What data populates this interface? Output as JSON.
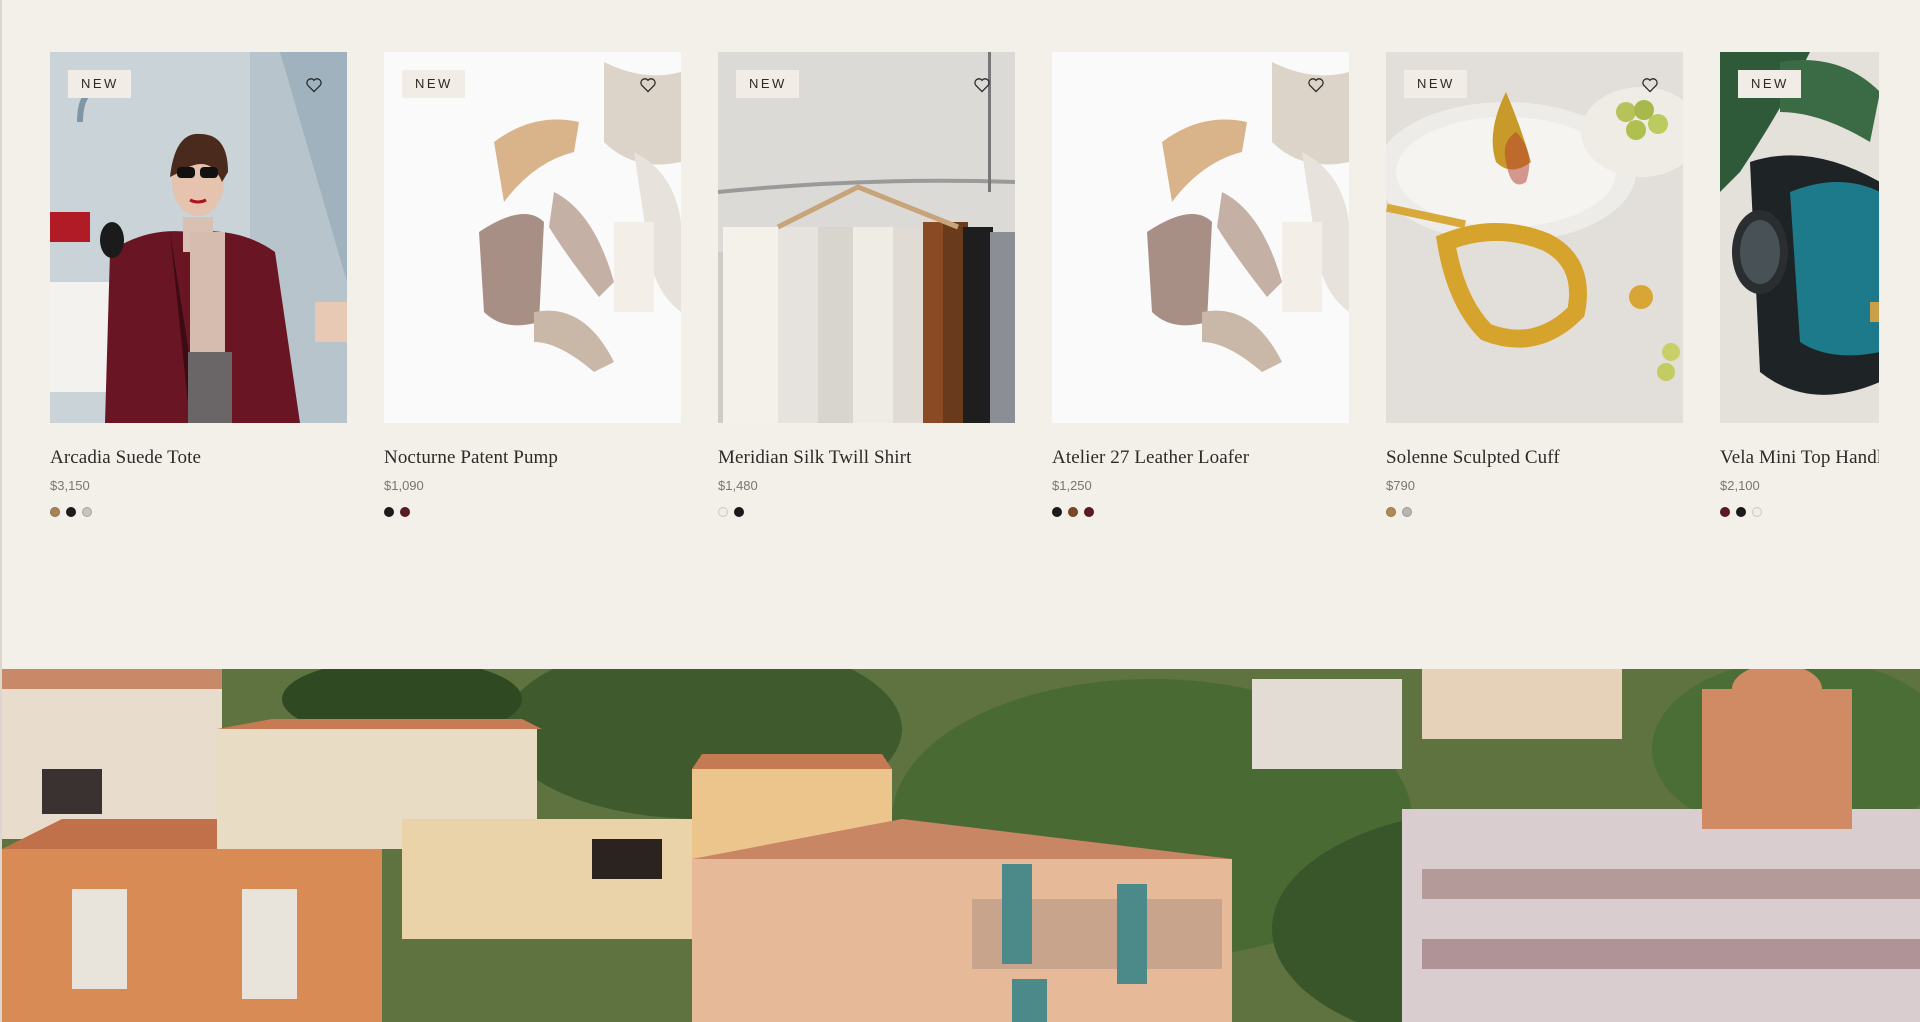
{
  "products": [
    {
      "badge": "NEW",
      "name": "Arcadia Suede Tote",
      "price": "$3,150",
      "swatches": [
        "#a88355",
        "#1d1d1d",
        "#c9c3b8"
      ]
    },
    {
      "badge": "NEW",
      "name": "Nocturne Patent Pump",
      "price": "$1,090",
      "swatches": [
        "#1b1b1b",
        "#5c1a22"
      ]
    },
    {
      "badge": "NEW",
      "name": "Meridian Silk Twill Shirt",
      "price": "$1,480",
      "swatches": [
        "#f2ede4",
        "#1a1a1a"
      ]
    },
    {
      "badge": "",
      "name": "Atelier 27 Leather Loafer",
      "price": "$1,250",
      "swatches": [
        "#1b1b1b",
        "#7a4a26",
        "#5c1a22"
      ]
    },
    {
      "badge": "NEW",
      "name": "Solenne Sculpted Cuff",
      "price": "$790",
      "swatches": [
        "#b08a52",
        "#b8b6b2"
      ]
    },
    {
      "badge": "NEW",
      "name": "Vela Mini Top Handle",
      "price": "$2,100",
      "swatches": [
        "#5c1a22",
        "#1a1a1a",
        "#f2ede4"
      ]
    }
  ],
  "icons": {
    "favorite": "heart-outline-icon"
  },
  "colors": {
    "background": "#f3efe9",
    "badge_bg": "#f1ece5",
    "text": "#2d2a27",
    "price": "#7b766f"
  }
}
